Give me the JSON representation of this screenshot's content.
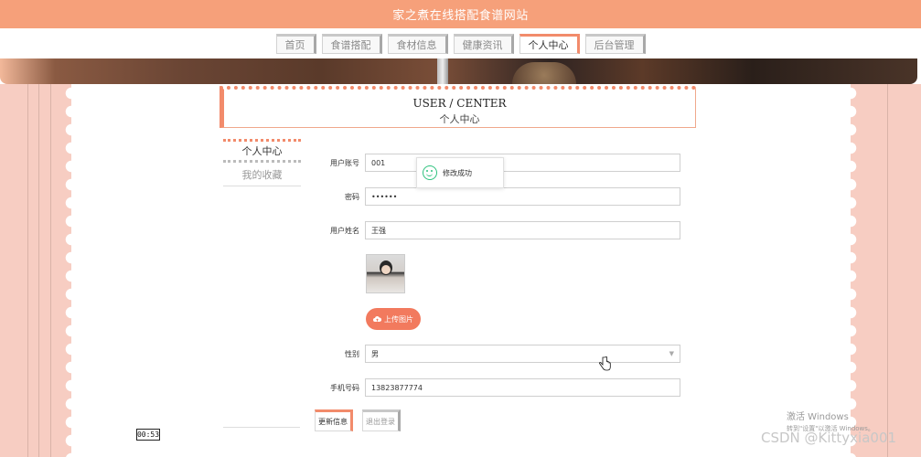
{
  "header": {
    "site_title": "家之煮在线搭配食谱网站"
  },
  "nav": {
    "items": [
      {
        "label": "首页",
        "active": false
      },
      {
        "label": "食谱搭配",
        "active": false
      },
      {
        "label": "食材信息",
        "active": false
      },
      {
        "label": "健康资讯",
        "active": false
      },
      {
        "label": "个人中心",
        "active": true
      },
      {
        "label": "后台管理",
        "active": false
      }
    ]
  },
  "section": {
    "title_en": "USER / CENTER",
    "title_cn": "个人中心"
  },
  "sidebar": {
    "items": [
      {
        "label": "个人中心",
        "active": true
      },
      {
        "label": "我的收藏",
        "active": false
      }
    ]
  },
  "form": {
    "account": {
      "label": "用户账号",
      "value": "001"
    },
    "password": {
      "label": "密码",
      "value": "••••••"
    },
    "name": {
      "label": "用户姓名",
      "value": "王强"
    },
    "upload_label": "上传图片",
    "gender": {
      "label": "性别",
      "value": "男"
    },
    "phone": {
      "label": "手机号码",
      "value": "13823877774"
    }
  },
  "buttons": {
    "update": "更新信息",
    "logout": "退出登录"
  },
  "toast": {
    "message": "修改成功"
  },
  "timer": "00:53",
  "watermark": {
    "activate_title": "激活 Windows",
    "activate_sub": "转到\"设置\"以激活 Windows。",
    "csdn": "CSDN @Kittyxia001"
  },
  "colors": {
    "accent": "#f28b6b",
    "title_bar": "#f6a07a",
    "curtain": "#f7cdc2",
    "success": "#2ec27e"
  }
}
